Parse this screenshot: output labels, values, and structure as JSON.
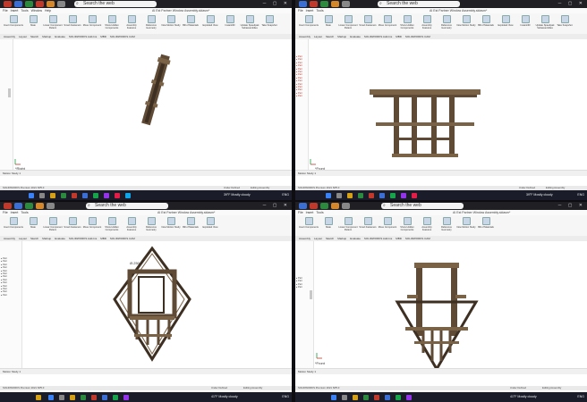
{
  "search_placeholder": "Search the web",
  "menu_items": [
    "File",
    "Insert",
    "Tools",
    "Window",
    "Help"
  ],
  "doc_title": "AI Est Partner Window Assembly.sldasm*",
  "cmd_tabs": [
    "Assembly",
    "Layout",
    "Sketch",
    "Markup",
    "Evaluate",
    "SOLIDWORKS Add-Ins",
    "MBD",
    "SOLIDWORKS CAM"
  ],
  "ribbon_buttons": [
    "Insert Components",
    "Mate",
    "Linear Component Pattern",
    "Smart Fasteners",
    "Move Component",
    "Show Hidden Components",
    "Assembly Features",
    "Reference Geometry",
    "New Motion Study",
    "Bill of Materials",
    "Exploded View",
    "Instant3D",
    "Update Speedpak Subassemblies",
    "Take Snapshot",
    "Large Assembly Settings"
  ],
  "views": {
    "q1": "*Right",
    "q2": "*Front",
    "q3": "",
    "q4": "*Front"
  },
  "status_left": "SOLIDWORKS Premium 2021 SP5.0",
  "status_right": [
    "Under Defined",
    "Editing Assembly"
  ],
  "sheet_tab": "Motion Study 1",
  "weather": [
    "Mostly cloudy",
    "Mostly cloudy",
    "Mostly cloudy",
    "Mostly cloudy"
  ],
  "temp": [
    "39°F",
    "39°F",
    "41°F",
    "41°F"
  ],
  "tray": "ENG",
  "dims": "Ø.250",
  "colors": {
    "wood": "#5f4a35",
    "wood_light": "#7a6247",
    "taskbar": "#1a1d29"
  },
  "icons": [
    "search-icon",
    "gmail-icon",
    "chrome-icon",
    "settings-icon",
    "start-icon",
    "file-explorer-icon",
    "solidworks-icon"
  ]
}
